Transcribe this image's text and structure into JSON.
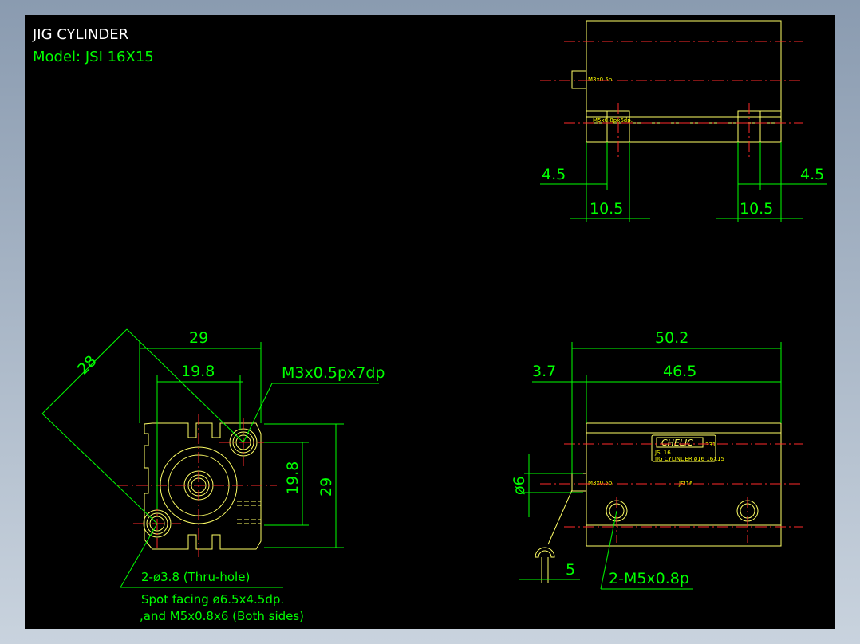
{
  "title": "JIG CYLINDER",
  "model": "Model: JSI 16X15",
  "top_view": {
    "label_thread": "M3x0.5p",
    "label_thread2": "M5x0.8px6dp.",
    "dim_left_small": "4.5",
    "dim_right_small": "4.5",
    "dim_left_width": "10.5",
    "dim_right_width": "10.5"
  },
  "front_view": {
    "dim_diag": "28",
    "dim_width": "29",
    "dim_bolt": "19.8",
    "dim_bolt_v": "19.8",
    "dim_height_v": "29",
    "note_tap": "M3x0.5px7dp",
    "note_hole_1": "2-ø3.8 (Thru-hole)",
    "note_hole_2": "Spot facing ø6.5x4.5dp.",
    "note_hole_3": ",and M5x0.8x6 (Both sides)"
  },
  "side_view": {
    "dim_total": "50.2",
    "dim_offset": "3.7",
    "dim_body": "46.5",
    "dim_dia": "ø6",
    "dim_5": "5",
    "label_thread": "M3x0.5p",
    "label_mount": "2-M5x0.8p",
    "brand": "CHELIC",
    "brand_sub": "331",
    "plate_line1": "JSI 16",
    "plate_line2": "JIG CYLINDER ø16 16X15",
    "body_text": "JSI16"
  },
  "colors": {
    "background": "#000000",
    "outline": "#ffff66",
    "dimension": "#00ff00",
    "centerline": "#ff2a2a"
  }
}
